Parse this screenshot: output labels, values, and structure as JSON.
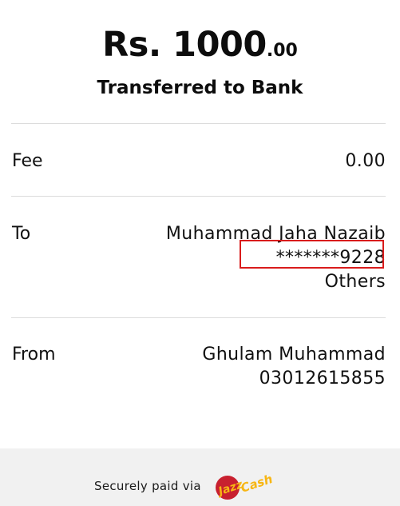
{
  "transaction": {
    "amount_main": "Rs. 1000",
    "amount_cents": ".00",
    "status": "Transferred to Bank"
  },
  "fee": {
    "label": "Fee",
    "value": "0.00"
  },
  "to": {
    "label": "To",
    "name": "Muhammad Jaha Nazaib",
    "account": "*******9228",
    "bank": "Others"
  },
  "from": {
    "label": "From",
    "name": "Ghulam Muhammad",
    "phone": "03012615855"
  },
  "footer": {
    "text": "Securely paid via",
    "logo_text": "JazzCash",
    "logo_part1": "Jazz",
    "logo_part2": "Cash"
  },
  "colors": {
    "highlight": "#d91c1c",
    "logo_red": "#c8202f",
    "logo_yellow": "#f7b614",
    "footer_bg": "#f1f1f1"
  }
}
